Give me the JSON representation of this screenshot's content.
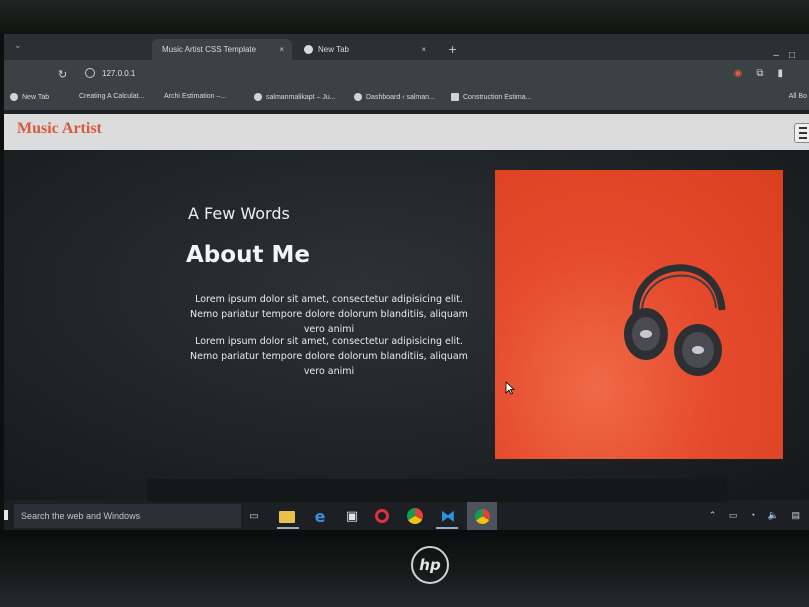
{
  "browser": {
    "tabs": [
      {
        "label": "Music Artist CSS Template",
        "close": "×"
      },
      {
        "label": "New Tab",
        "close": "×"
      }
    ],
    "new_tab": "+",
    "address": "127.0.0.1",
    "bookmarks": [
      "New Tab",
      "Creating A Calculat...",
      "Archi Estimation –...",
      "salmanmalikapt – Ju...",
      "Dashboard ‹ salman...",
      "Construction Estima...",
      "All Bo"
    ]
  },
  "site": {
    "logo": "Music Artist",
    "about": {
      "subtitle": "A Few Words",
      "title": "About Me",
      "paragraphs": [
        "Lorem ipsum dolor sit amet, consectetur adipisicing elit. Nemo pariatur tempore dolore dolorum blanditiis, aliquam vero animi",
        "Lorem ipsum dolor sit amet, consectetur adipisicing elit. Nemo pariatur tempore dolore dolorum blanditiis, aliquam vero animi"
      ]
    },
    "image_colors": {
      "background": "#e54a2c",
      "headphones": "#2e2f33"
    }
  },
  "taskbar": {
    "search_placeholder": "Search the web and Windows",
    "apps": [
      "task-view",
      "file-explorer",
      "edge",
      "store",
      "opera",
      "chrome",
      "vscode",
      "chrome-active"
    ]
  },
  "device": {
    "brand": "hp"
  }
}
